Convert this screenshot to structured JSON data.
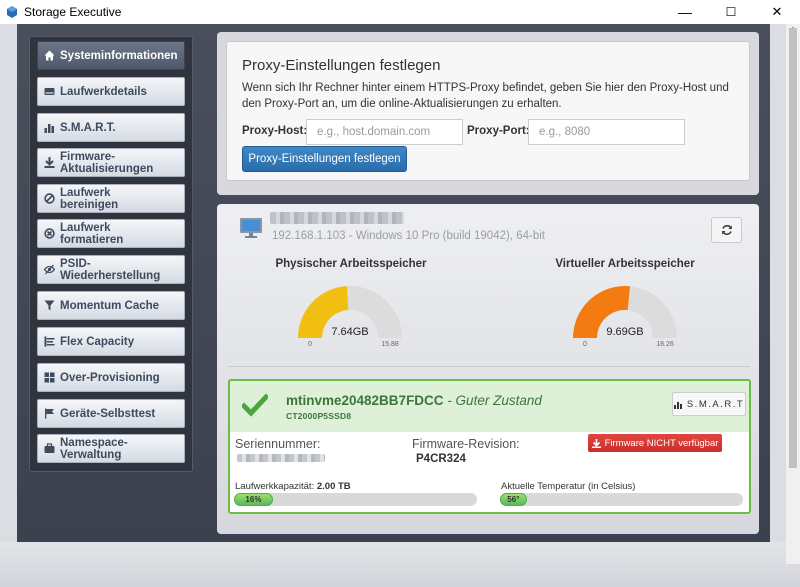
{
  "window": {
    "title": "Storage Executive",
    "minimize": "—",
    "maximize": "☐",
    "close": "✕"
  },
  "colors": {
    "active_nav": "#5d6779",
    "gauge_physical": "#f0bf12",
    "gauge_virtual": "#f47b12",
    "gauge_track": "#dcdcdc",
    "healthy_green": "#3c763d",
    "primary_blue": "#2f79bd",
    "danger_red": "#d9534f"
  },
  "sidebar": {
    "items": [
      {
        "label": "Systeminformationen",
        "icon": "home-icon",
        "active": true
      },
      {
        "label": "Laufwerkdetails",
        "icon": "hdd-icon"
      },
      {
        "label": "S.M.A.R.T.",
        "icon": "bar-chart-icon"
      },
      {
        "label": "Firmware-\nAktualisierungen",
        "icon": "download-icon"
      },
      {
        "label": "Laufwerk\nbereinigen",
        "icon": "ban-icon"
      },
      {
        "label": "Laufwerk\nformatieren",
        "icon": "x-circle-icon"
      },
      {
        "label": "PSID-\nWiederherstellung",
        "icon": "eye-slash-icon"
      },
      {
        "label": "Momentum Cache",
        "icon": "filter-icon"
      },
      {
        "label": "Flex Capacity",
        "icon": "list-icon"
      },
      {
        "label": "Over-Provisioning",
        "icon": "grid-icon"
      },
      {
        "label": "Geräte-Selbsttest",
        "icon": "flag-icon"
      },
      {
        "label": "Namespace-\nVerwaltung",
        "icon": "briefcase-icon"
      }
    ]
  },
  "proxy": {
    "title": "Proxy-Einstellungen festlegen",
    "description": "Wenn sich Ihr Rechner hinter einem HTTPS-Proxy befindet, geben Sie hier den Proxy-Host und den Proxy-Port an, um die online-Aktualisierungen zu erhalten.",
    "host_label": "Proxy-Host:",
    "host_placeholder": "e.g., host.domain.com",
    "host_value": "",
    "port_label": "Proxy-Port:",
    "port_placeholder": "e.g., 8080",
    "port_value": "",
    "button_label": "Proxy-Einstellungen festlegen"
  },
  "system": {
    "host_info": "192.168.1.103 - Windows 10 Pro (build 19042), 64-bit"
  },
  "gauges": [
    {
      "title": "Physischer Arbeitsspeicher",
      "value": 7.64,
      "value_label": "7.64GB",
      "min": 0,
      "max": 15.88,
      "min_label": "0",
      "max_label": "15.88",
      "color": "#f0bf12"
    },
    {
      "title": "Virtueller Arbeitsspeicher",
      "value": 9.69,
      "value_label": "9.69GB",
      "min": 0,
      "max": 18.26,
      "min_label": "0",
      "max_label": "18.26",
      "color": "#f47b12"
    }
  ],
  "drive": {
    "name": "mtinvme20482BB7FDCC",
    "status": " - Guter Zustand",
    "model": "CT2000P5SSD8",
    "smart_button": "S.M.A.R.T",
    "serial_label": "Seriennummer:",
    "firmware_label": "Firmware-Revision:",
    "firmware_value": "P4CR324",
    "firmware_button": "Firmware NICHT verfügbar",
    "capacity_label": "Laufwerkkapazität:",
    "capacity_value": "2.00 TB",
    "capacity_used_percent": 16,
    "capacity_bar_label": "16%",
    "temp_label": "Aktuelle Temperatur (in Celsius)",
    "temp_value": 56,
    "temp_bar_label": "56°",
    "temp_fraction": 0.11
  }
}
